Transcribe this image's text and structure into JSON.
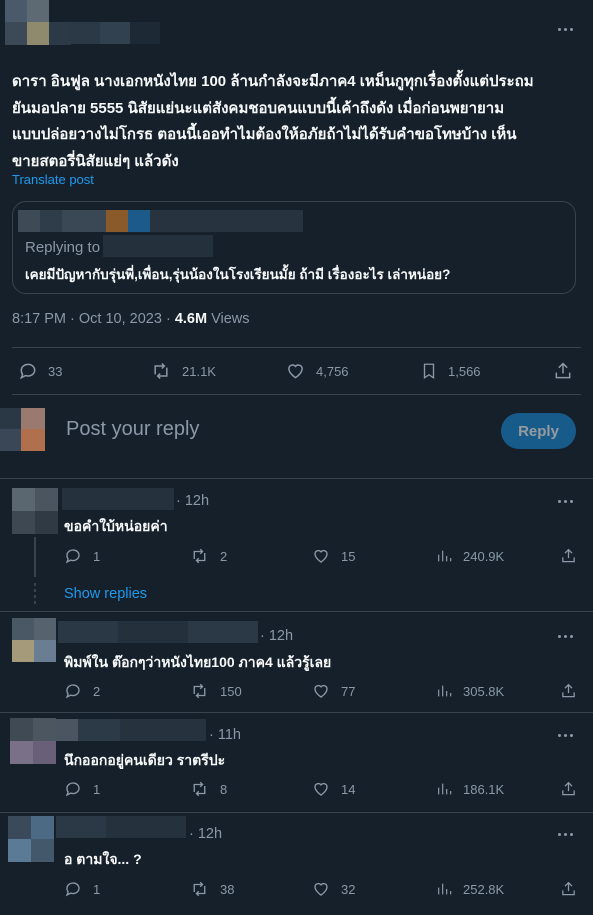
{
  "post": {
    "text": "ดารา อินฟูล นางเอกหนังไทย 100 ล้านกำลังจะมีภาค4  เหม็นกูทุกเรื่องตั้งแต่ประถม\nยันมอปลาย 5555 นิสัยแย่นะแต่สังคมชอบคนแบบนี้เค้าถึงดัง  เมื่อก่อนพยายาม\nแบบปล่อยวางไม่โกรธ ตอนนี้เออทำไมต้องให้อภัยถ้าไม่ได้รับคำขอโทษบ้าง เห็น\nขายสตอรี่นิสัยแย่ๆ แล้วดัง",
    "translate_label": "Translate post",
    "quote": {
      "replying_label": "Replying to",
      "text": "เคยมีปัญหากับรุ่นพี่,เพื่อน,รุ่นน้องในโรงเรียนมั้ย ถ้ามี เรื่องอะไร เล่าหน่อย?"
    },
    "timestamp": "8:17 PM · Oct 10, 2023 · ",
    "views_count": "4.6M",
    "views_label": " Views",
    "stats": {
      "replies": "33",
      "reposts": "21.1K",
      "likes": "4,756",
      "bookmarks": "1,566"
    }
  },
  "composer": {
    "placeholder": "Post your reply",
    "button_label": "Reply"
  },
  "replies": [
    {
      "time": "· 12h",
      "text": "ขอคำใบ้หน่อยค่า",
      "replies": "1",
      "reposts": "2",
      "likes": "15",
      "views": "240.9K",
      "show_replies": "Show replies"
    },
    {
      "time": "· 12h",
      "text": "พิมพ์ใน ต๊อกๆว่าหนังไทย100 ภาค4 แล้วรู้เลย",
      "replies": "2",
      "reposts": "150",
      "likes": "77",
      "views": "305.8K"
    },
    {
      "time": "· 11h",
      "text": "นึกออกอยู่คนเดียว ราตรีปะ",
      "replies": "1",
      "reposts": "8",
      "likes": "14",
      "views": "186.1K"
    },
    {
      "time": "· 12h",
      "text": "อ ตามใจ... ?",
      "replies": "1",
      "reposts": "38",
      "likes": "32",
      "views": "252.8K"
    }
  ],
  "icons": {
    "reply": "reply-icon",
    "repost": "repost-icon",
    "like": "heart-icon",
    "bookmark": "bookmark-icon",
    "share": "share-icon",
    "views": "views-icon",
    "more": "more-icon"
  },
  "colors": {
    "background": "#15202b",
    "accent": "#1d9bf0",
    "muted": "#8b98a5",
    "border": "#38444d"
  }
}
